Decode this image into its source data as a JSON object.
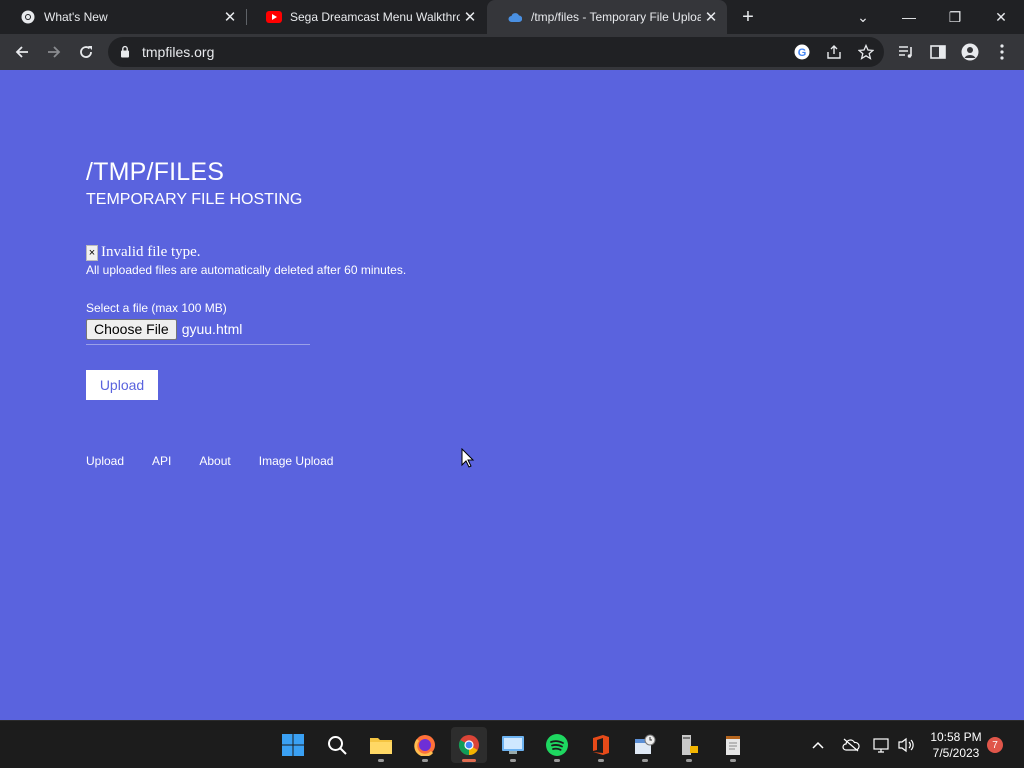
{
  "browser": {
    "tabs": [
      {
        "title": "What's New",
        "active": false
      },
      {
        "title": "Sega Dreamcast Menu Walkthrou",
        "active": false
      },
      {
        "title": "/tmp/files - Temporary File Uploa",
        "active": true
      }
    ],
    "address": "tmpfiles.org"
  },
  "page": {
    "title": "/TMP/FILES",
    "subtitle": "TEMPORARY FILE HOSTING",
    "error_close": "×",
    "error_message": "Invalid file type.",
    "note": "All uploaded files are automatically deleted after 60 minutes.",
    "file_label": "Select a file (max 100 MB)",
    "choose_file_label": "Choose File",
    "selected_file": "gyuu.html",
    "upload_label": "Upload",
    "footer_links": [
      "Upload",
      "API",
      "About",
      "Image Upload"
    ]
  },
  "taskbar": {
    "time": "10:58 PM",
    "date": "7/5/2023",
    "notifications": "7"
  },
  "colors": {
    "page_background": "#5a63de",
    "tab_strip": "#202124",
    "toolbar": "#35363a",
    "taskbar": "#1c1c1c"
  }
}
